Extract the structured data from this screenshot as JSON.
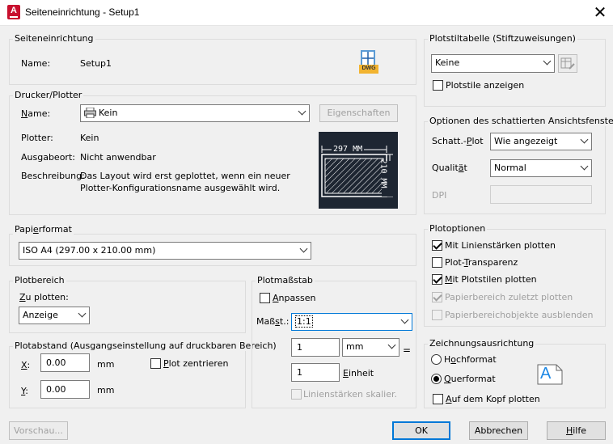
{
  "window": {
    "title": "Seiteneinrichtung - Setup1",
    "app_icon_letter": "A"
  },
  "setup": {
    "group_label": "Seiteneinrichtung",
    "name_label": "Name:",
    "name_value": "Setup1",
    "dwg_icon_text": "DWG"
  },
  "printer": {
    "group_label": "Drucker/Plotter",
    "name_label": "Name:",
    "name_value": "Kein",
    "properties_button": "Eigenschaften",
    "plotter_label": "Plotter:",
    "plotter_value": "Kein",
    "location_label": "Ausgabeort:",
    "location_value": "Nicht anwendbar",
    "description_label": "Beschreibung:",
    "description_line1": "Das Layout wird erst geplottet, wenn ein neuer",
    "description_line2": "Plotter-Konfigurationsname ausgewählt wird.",
    "preview_width_label": "297 MM",
    "preview_height_label": "210 MM"
  },
  "paper": {
    "group_label": "Papierformat",
    "value": "ISO A4 (297.00 x 210.00 mm)"
  },
  "plot_area": {
    "group_label": "Plotbereich",
    "what_label": "Zu plotten:",
    "what_value": "Anzeige"
  },
  "plot_offset": {
    "group_label": "Plotabstand (Ausgangseinstellung auf druckbaren Bereich)",
    "x_label": "X:",
    "x_value": "0.00",
    "x_unit": "mm",
    "y_label": "Y:",
    "y_value": "0.00",
    "y_unit": "mm",
    "center_label": "Plot zentrieren",
    "center_checked": false
  },
  "plot_scale": {
    "group_label": "Plotmaßstab",
    "fit_label": "Anpassen",
    "fit_checked": false,
    "scale_label": "Maßst.:",
    "scale_value": "1:1",
    "value1": "1",
    "unit_value": "mm",
    "equals": "=",
    "value2": "1",
    "unit2_label": "Einheit",
    "lineweights_label": "Linienstärken skalier.",
    "lineweights_checked": false
  },
  "plotstyle": {
    "group_label": "Plotstiltabelle (Stiftzuweisungen)",
    "value": "Keine",
    "show_label": "Plotstile anzeigen",
    "show_checked": false
  },
  "shaded": {
    "group_label": "Optionen des schattierten Ansichtsfensters",
    "shade_label": "Schatt.-Plot",
    "shade_value": "Wie angezeigt",
    "quality_label": "Qualität",
    "quality_value": "Normal",
    "dpi_label": "DPI",
    "dpi_value": ""
  },
  "plot_options": {
    "group_label": "Plotoptionen",
    "items": [
      {
        "label": "Mit Linienstärken plotten",
        "checked": true,
        "disabled": false
      },
      {
        "label": "Plot-Transparenz",
        "checked": false,
        "disabled": false
      },
      {
        "label": "Mit Plotstilen plotten",
        "checked": true,
        "disabled": false
      },
      {
        "label": "Papierbereich zuletzt plotten",
        "checked": true,
        "disabled": true
      },
      {
        "label": "Papierbereichobjekte ausblenden",
        "checked": false,
        "disabled": true
      }
    ]
  },
  "orientation": {
    "group_label": "Zeichnungsausrichtung",
    "portrait_label": "Hochformat",
    "landscape_label": "Querformat",
    "selected": "landscape",
    "upside_down_label": "Auf dem Kopf plotten",
    "upside_down_checked": false,
    "icon_letter": "A"
  },
  "buttons": {
    "preview": "Vorschau...",
    "ok": "OK",
    "cancel": "Abbrechen",
    "help": "Hilfe"
  }
}
